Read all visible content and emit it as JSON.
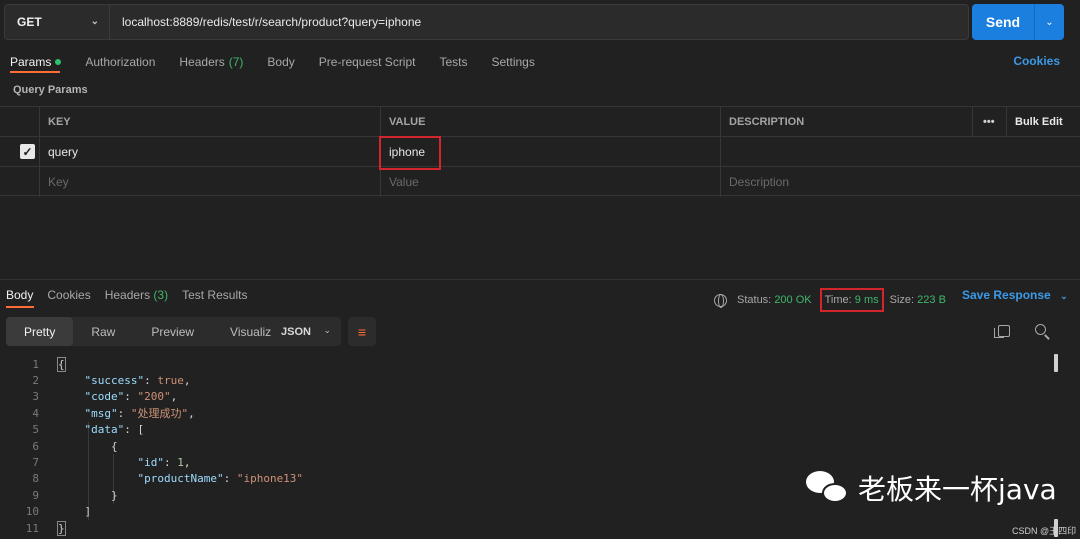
{
  "request": {
    "method": "GET",
    "url": "localhost:8889/redis/test/r/search/product?query=iphone",
    "send_label": "Send"
  },
  "req_tabs": [
    {
      "label": "Params",
      "active": true,
      "dot": true
    },
    {
      "label": "Authorization"
    },
    {
      "label": "Headers",
      "count": "(7)"
    },
    {
      "label": "Body"
    },
    {
      "label": "Pre-request Script"
    },
    {
      "label": "Tests"
    },
    {
      "label": "Settings"
    }
  ],
  "cookies_label": "Cookies",
  "query_params_title": "Query Params",
  "params_table": {
    "headers": {
      "key": "KEY",
      "value": "VALUE",
      "description": "DESCRIPTION",
      "more": "•••",
      "bulk_edit": "Bulk Edit"
    },
    "rows": [
      {
        "key": "query",
        "value": "iphone",
        "description": "",
        "checked": true
      }
    ],
    "placeholders": {
      "key": "Key",
      "value": "Value",
      "description": "Description"
    }
  },
  "resp_tabs": [
    {
      "label": "Body",
      "active": true
    },
    {
      "label": "Cookies"
    },
    {
      "label": "Headers",
      "count": "(3)"
    },
    {
      "label": "Test Results"
    }
  ],
  "status": {
    "status_label": "Status:",
    "status_value": "200 OK",
    "time_label": "Time:",
    "time_value": "9 ms",
    "size_label": "Size:",
    "size_value": "223 B"
  },
  "save_response_label": "Save Response",
  "view_modes": [
    "Pretty",
    "Raw",
    "Preview",
    "Visualize"
  ],
  "format": "JSON",
  "line_numbers": [
    "1",
    "2",
    "3",
    "4",
    "5",
    "6",
    "7",
    "8",
    "9",
    "10",
    "11"
  ],
  "json_body": {
    "l2_key": "\"success\"",
    "l2_val": "true",
    "l3_key": "\"code\"",
    "l3_val": "\"200\"",
    "l4_key": "\"msg\"",
    "l4_val": "\"处理成功\"",
    "l5_key": "\"data\"",
    "l7_key": "\"id\"",
    "l7_val": "1",
    "l8_key": "\"productName\"",
    "l8_val": "\"iphone13\""
  },
  "watermark": {
    "text": "老板来一杯java",
    "csdn": "CSDN @王四印"
  },
  "colors": {
    "accent": "#ff6c37",
    "send": "#1b7fe0",
    "link": "#3b9ae8",
    "ok_green": "#3fb76a",
    "highlight_red": "#d4242c"
  }
}
